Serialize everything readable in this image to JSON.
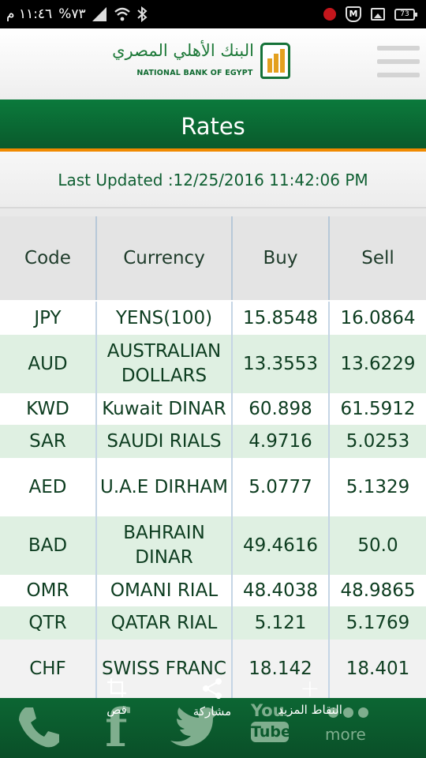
{
  "status_bar": {
    "time": "١١:٤٦ م",
    "battery_pct": "%٧٣",
    "battery_badge": "73"
  },
  "header": {
    "logo_arabic": "البنك الأهلي المصري",
    "logo_english": "NATIONAL BANK OF EGYPT"
  },
  "title": "Rates",
  "last_updated": "Last Updated :12/25/2016 11:42:06 PM",
  "table": {
    "headers": [
      "Code",
      "Currency",
      "Buy",
      "Sell"
    ],
    "rows": [
      {
        "code": "JPY",
        "currency": "YENS(100)",
        "buy": "15.8548",
        "sell": "16.0864"
      },
      {
        "code": "AUD",
        "currency": "AUSTRALIAN DOLLARS",
        "buy": "13.3553",
        "sell": "13.6229"
      },
      {
        "code": "KWD",
        "currency": "Kuwait DINAR",
        "buy": "60.898",
        "sell": "61.5912"
      },
      {
        "code": "SAR",
        "currency": "SAUDI RIALS",
        "buy": "4.9716",
        "sell": "5.0253"
      },
      {
        "code": "AED",
        "currency": "U.A.E DIRHAM",
        "buy": "5.0777",
        "sell": "5.1329"
      },
      {
        "code": "BAD",
        "currency": "BAHRAIN DINAR",
        "buy": "49.4616",
        "sell": "50.0"
      },
      {
        "code": "OMR",
        "currency": "OMANI RIAL",
        "buy": "48.4038",
        "sell": "48.9865"
      },
      {
        "code": "QTR",
        "currency": "QATAR RIAL",
        "buy": "5.121",
        "sell": "5.1769"
      },
      {
        "code": "CHF",
        "currency": "SWISS FRANC",
        "buy": "18.142",
        "sell": "18.401"
      }
    ]
  },
  "bottom_bar": {
    "youtube_you": "You",
    "youtube_tube": "Tube",
    "more_label": "more"
  },
  "screenshot_actions": {
    "crop": "قص",
    "share": "مشاركة",
    "scroll_capture": "النقاط المزيد"
  },
  "colors": {
    "brand_green": "#0b7a3c",
    "accent_orange": "#f08a00",
    "row_alt": "#dff0e2"
  }
}
